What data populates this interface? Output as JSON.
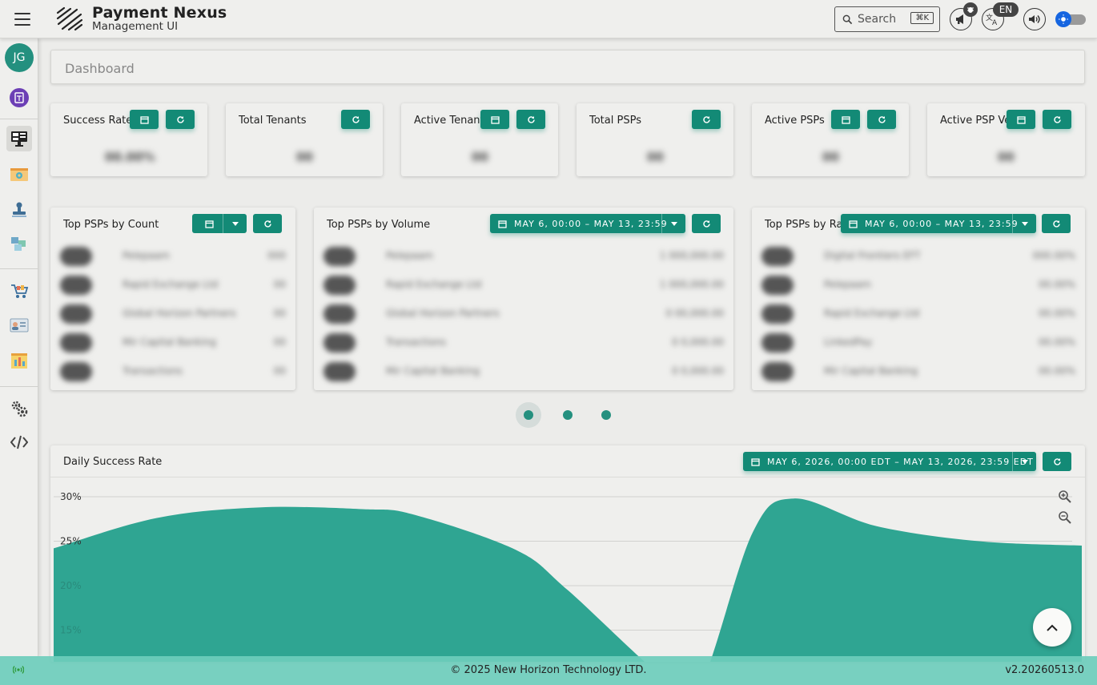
{
  "header": {
    "brand_title": "Payment Nexus",
    "brand_subtitle": "Management UI",
    "search_label": "Search",
    "search_shortcut": "⌘K",
    "language": "EN"
  },
  "sidebar": {
    "avatar_initials": "JG"
  },
  "breadcrumb": {
    "title": "Dashboard"
  },
  "stats": [
    {
      "title": "Success Rate"
    },
    {
      "title": "Total Tenants"
    },
    {
      "title": "Active Tenants"
    },
    {
      "title": "Total PSPs"
    },
    {
      "title": "Active PSPs"
    },
    {
      "title": "Active PSP Ve..."
    }
  ],
  "panels": {
    "by_count": {
      "title": "Top PSPs by Count"
    },
    "by_volume": {
      "title": "Top PSPs by Volume",
      "range": "MAY 6, 00:00 – MAY 13, 23:59"
    },
    "by_rate": {
      "title": "Top PSPs by Ra...",
      "range": "MAY 6, 00:00 – MAY 13, 23:59"
    }
  },
  "chart_section": {
    "title": "Daily Success Rate",
    "range": "MAY 6, 2026, 00:00 EDT – MAY 13, 2026, 23:59 EDT"
  },
  "chart_data": {
    "type": "area",
    "title": "Daily Success Rate",
    "ylabel": "",
    "y_tick_labels": [
      "30%",
      "25%",
      "20%",
      "15%"
    ],
    "ylim": [
      10,
      30
    ],
    "grid": true,
    "color": "#2fa592",
    "x": [
      0,
      0.1,
      0.2,
      0.3,
      0.35,
      0.45,
      0.5,
      0.6,
      0.63,
      0.68,
      0.72,
      0.8,
      0.9,
      1.0
    ],
    "values": [
      24.2,
      27.6,
      28.8,
      28.6,
      28.0,
      24.0,
      19.5,
      9.0,
      9.0,
      26.0,
      29.8,
      26.7,
      25.0,
      24.5
    ]
  },
  "footer": {
    "copyright": "© 2025 New Horizon Technology LTD.",
    "version": "v2.20260513.0"
  },
  "colors": {
    "accent": "#138a76",
    "avatar": "#24907f",
    "toggle": "#1565e0"
  }
}
